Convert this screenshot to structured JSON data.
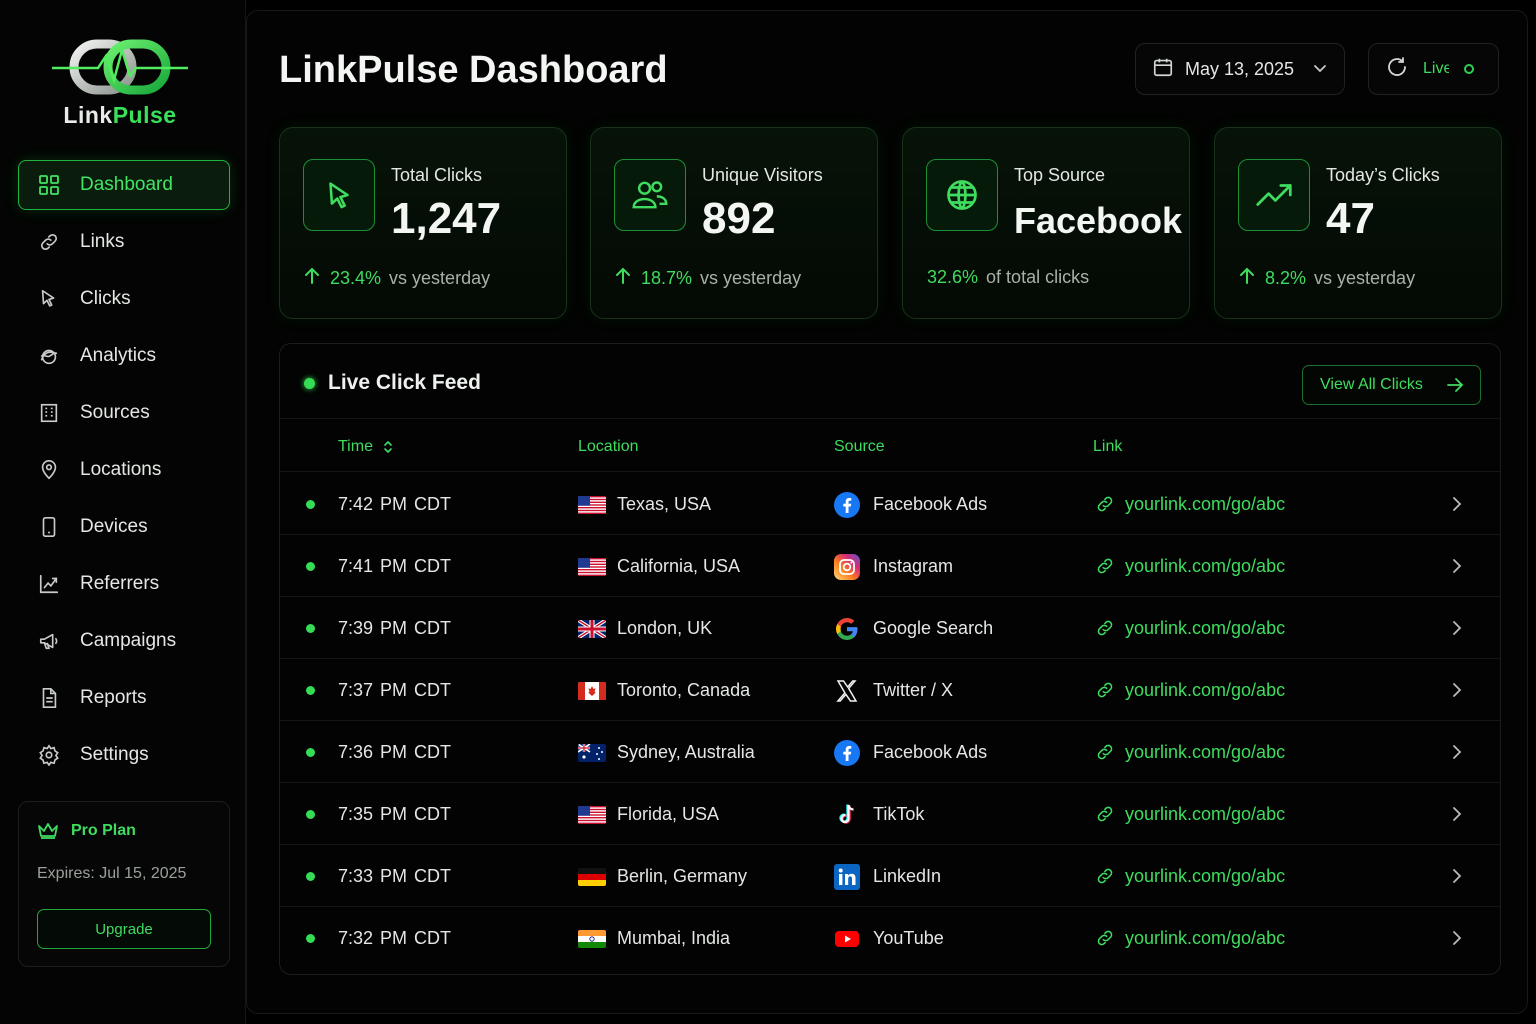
{
  "brand": {
    "word_a": "Link",
    "word_b": "Pulse",
    "logo_icon": "chain-pulse-logo"
  },
  "sidebar": {
    "items": [
      {
        "label": "Dashboard",
        "icon": "grid-icon",
        "active": true
      },
      {
        "label": "Links",
        "icon": "link-icon"
      },
      {
        "label": "Clicks",
        "icon": "cursor-icon"
      },
      {
        "label": "Analytics",
        "icon": "analytics-icon"
      },
      {
        "label": "Sources",
        "icon": "building-icon"
      },
      {
        "label": "Locations",
        "icon": "pin-icon"
      },
      {
        "label": "Devices",
        "icon": "phone-icon"
      },
      {
        "label": "Referrers",
        "icon": "referrer-chart-icon"
      },
      {
        "label": "Campaigns",
        "icon": "megaphone-icon"
      },
      {
        "label": "Reports",
        "icon": "document-icon"
      },
      {
        "label": "Settings",
        "icon": "gear-icon"
      }
    ],
    "plan": {
      "title": "Pro Plan",
      "expires": "Expires: Jul 15, 2025",
      "button": "Upgrade"
    }
  },
  "header": {
    "title": "LinkPulse Dashboard",
    "date": "May 13, 2025",
    "live_label": "Live"
  },
  "stats": [
    {
      "label": "Total Clicks",
      "value": "1,247",
      "pct": "23.4%",
      "rest": "vs yesterday",
      "arrow": true,
      "icon": "cursor-icon"
    },
    {
      "label": "Unique Visitors",
      "value": "892",
      "pct": "18.7%",
      "rest": "vs yesterday",
      "arrow": true,
      "icon": "users-icon"
    },
    {
      "label": "Top Source",
      "value": "Facebook",
      "pct": "32.6%",
      "rest": "of total clicks",
      "arrow": false,
      "icon": "globe-icon"
    },
    {
      "label": "Today’s Clicks",
      "value": "47",
      "pct": "8.2%",
      "rest": "vs yesterday",
      "arrow": true,
      "icon": "trending-up-icon"
    }
  ],
  "feed": {
    "title": "Live Click Feed",
    "view_all": "View All Clicks",
    "columns": {
      "time": "Time",
      "location": "Location",
      "source": "Source",
      "link": "Link"
    },
    "rows": [
      {
        "time": "7:42 PM CDT",
        "location": "Texas, USA",
        "flag": "us",
        "source": "Facebook Ads",
        "source_icon": "facebook",
        "link": "yourlink.com/go/abc"
      },
      {
        "time": "7:41 PM CDT",
        "location": "California, USA",
        "flag": "us",
        "source": "Instagram",
        "source_icon": "instagram",
        "link": "yourlink.com/go/abc"
      },
      {
        "time": "7:39 PM CDT",
        "location": "London, UK",
        "flag": "uk",
        "source": "Google Search",
        "source_icon": "google",
        "link": "yourlink.com/go/abc"
      },
      {
        "time": "7:37 PM CDT",
        "location": "Toronto, Canada",
        "flag": "ca",
        "source": "Twitter / X",
        "source_icon": "x",
        "link": "yourlink.com/go/abc"
      },
      {
        "time": "7:36 PM CDT",
        "location": "Sydney, Australia",
        "flag": "au",
        "source": "Facebook Ads",
        "source_icon": "facebook",
        "link": "yourlink.com/go/abc"
      },
      {
        "time": "7:35 PM CDT",
        "location": "Florida, USA",
        "flag": "us",
        "source": "TikTok",
        "source_icon": "tiktok",
        "link": "yourlink.com/go/abc"
      },
      {
        "time": "7:33 PM CDT",
        "location": "Berlin, Germany",
        "flag": "de",
        "source": "LinkedIn",
        "source_icon": "linkedin",
        "link": "yourlink.com/go/abc"
      },
      {
        "time": "7:32 PM CDT",
        "location": "Mumbai, India",
        "flag": "in",
        "source": "YouTube",
        "source_icon": "youtube",
        "link": "yourlink.com/go/abc"
      }
    ]
  },
  "colors": {
    "accent": "#3fdc5f",
    "background": "#000000",
    "card": "#061308"
  }
}
